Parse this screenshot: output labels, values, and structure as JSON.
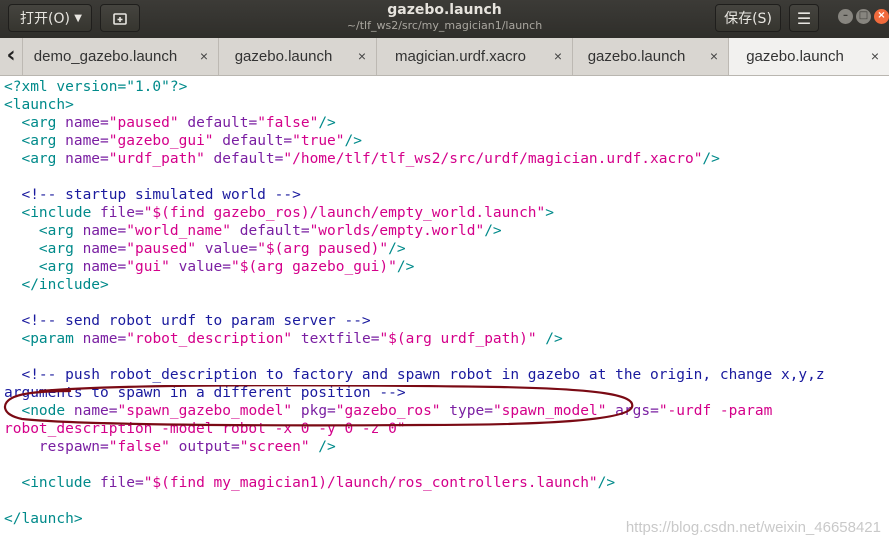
{
  "header": {
    "open_label": "打开(O)",
    "title": "gazebo.launch",
    "subtitle": "~/tlf_ws2/src/my_magician1/launch",
    "save_label": "保存(S)",
    "menu_glyph": "☰"
  },
  "tabs": [
    {
      "label": "demo_gazebo.launch",
      "close": "×"
    },
    {
      "label": "gazebo.launch",
      "close": "×"
    },
    {
      "label": "magician.urdf.xacro",
      "close": "×"
    },
    {
      "label": "gazebo.launch",
      "close": "×"
    },
    {
      "label": "gazebo.launch",
      "close": "×"
    }
  ],
  "code": {
    "l1": {
      "tag": "<?xml version=\"1.0\"?>"
    },
    "l2": {
      "tag": "<launch>"
    },
    "l3": {
      "p1": "  ",
      "tag": "<arg",
      "a1": " name=",
      "v1": "\"paused\"",
      "a2": " default=",
      "v2": "\"false\"",
      "end": "/>"
    },
    "l4": {
      "p1": "  ",
      "tag": "<arg",
      "a1": " name=",
      "v1": "\"gazebo_gui\"",
      "a2": " default=",
      "v2": "\"true\"",
      "end": "/>"
    },
    "l5": {
      "p1": "  ",
      "tag": "<arg",
      "a1": " name=",
      "v1": "\"urdf_path\"",
      "a2": " default=",
      "v2": "\"/home/tlf/tlf_ws2/src/urdf/magician.urdf.xacro\"",
      "end": "/>"
    },
    "l7": {
      "p1": "  ",
      "comment": "<!-- startup simulated world -->"
    },
    "l8": {
      "p1": "  ",
      "tag": "<include",
      "a1": " file=",
      "v1": "\"$(find gazebo_ros)/launch/empty_world.launch\"",
      "end": ">"
    },
    "l9": {
      "p1": "    ",
      "tag": "<arg",
      "a1": " name=",
      "v1": "\"world_name\"",
      "a2": " default=",
      "v2": "\"worlds/empty.world\"",
      "end": "/>"
    },
    "l10": {
      "p1": "    ",
      "tag": "<arg",
      "a1": " name=",
      "v1": "\"paused\"",
      "a2": " value=",
      "v2": "\"$(arg paused)\"",
      "end": "/>"
    },
    "l11": {
      "p1": "    ",
      "tag": "<arg",
      "a1": " name=",
      "v1": "\"gui\"",
      "a2": " value=",
      "v2": "\"$(arg gazebo_gui)\"",
      "end": "/>"
    },
    "l12": {
      "p1": "  ",
      "tag": "</include>"
    },
    "l14": {
      "p1": "  ",
      "comment": "<!-- send robot urdf to param server -->"
    },
    "l15": {
      "p1": "  ",
      "tag": "<param",
      "a1": " name=",
      "v1": "\"robot_description\"",
      "a2": " textfile=",
      "v2": "\"$(arg urdf_path)\"",
      "end": " />"
    },
    "l17": {
      "p1": "  ",
      "comment": "<!-- push robot_description to factory and spawn robot in gazebo at the origin, change x,y,z"
    },
    "l18": {
      "comment": "arguments to spawn in a different position -->"
    },
    "l19": {
      "p1": "  ",
      "tag": "<node",
      "a1": " name=",
      "v1": "\"spawn_gazebo_model\"",
      "a2": " pkg=",
      "v2": "\"gazebo_ros\"",
      "a3": " type=",
      "v3": "\"spawn_model\"",
      "a4": " args=",
      "v4": "\"-urdf -param"
    },
    "l20": {
      "v1": "robot_description -model robot -x 0 -y 0 -z 0\""
    },
    "l21": {
      "p1": "    ",
      "a1": "respawn=",
      "v1": "\"false\"",
      "a2": " output=",
      "v2": "\"screen\"",
      "end": " />"
    },
    "l23": {
      "p1": "  ",
      "tag": "<include",
      "a1": " file=",
      "v1": "\"$(find my_magician1)/launch/ros_controllers.launch\"",
      "end": "/>"
    },
    "l25": {
      "tag": "</launch>"
    }
  },
  "watermark": "https://blog.csdn.net/weixin_46658421",
  "colors": {
    "tag": "#008a8a",
    "attribute": "#7a1fa2",
    "string": "#d4008a",
    "comment": "#1a1a9e",
    "annotation_ellipse": "#7a0a14"
  }
}
